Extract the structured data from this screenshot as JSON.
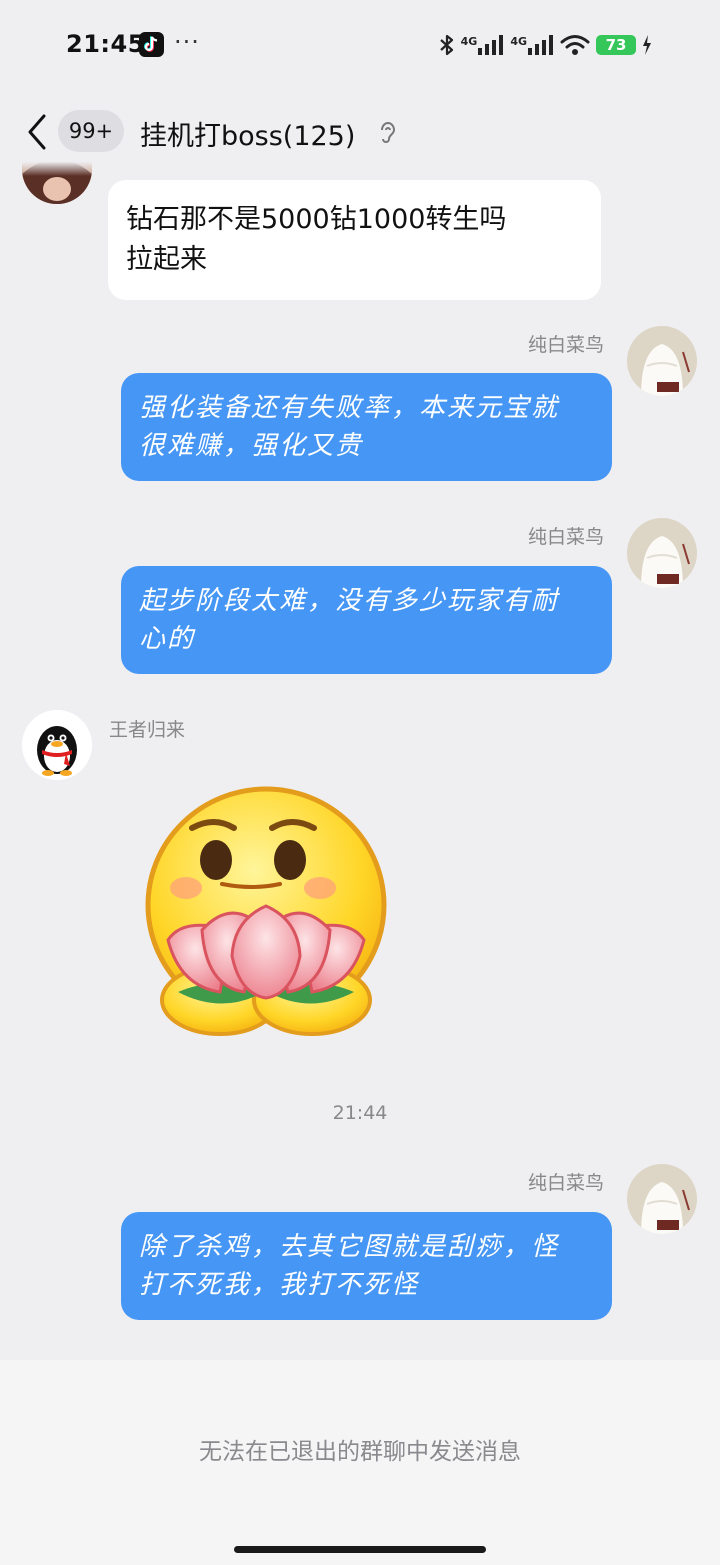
{
  "status_bar": {
    "time": "21:45",
    "more": "···",
    "net1": "4G",
    "net2": "4G",
    "battery": "73",
    "icons": [
      "tiktok-icon",
      "bluetooth-icon",
      "signal-icon",
      "wifi-icon",
      "battery-icon",
      "charging-icon"
    ]
  },
  "header": {
    "unread_badge": "99+",
    "title": "挂机打boss(125)",
    "icons": [
      "back-arrow-icon",
      "ear-icon"
    ]
  },
  "messages": [
    {
      "type": "incoming",
      "text_lines": [
        "钻石那不是5000钻1000转生吗",
        "拉起来"
      ]
    },
    {
      "type": "outgoing",
      "sender": "纯白菜鸟",
      "text_lines": [
        "强化装备还有失败率，本来元宝就",
        "很难赚，强化又贵"
      ]
    },
    {
      "type": "outgoing",
      "sender": "纯白菜鸟",
      "text_lines": [
        "起步阶段太难，没有多少玩家有耐",
        "心的"
      ]
    },
    {
      "type": "incoming_sticker",
      "sender": "王者归来",
      "sticker": "lotus-emoji-sticker"
    },
    {
      "type": "outgoing",
      "sender": "纯白菜鸟",
      "text_lines": [
        "除了杀鸡，去其它图就是刮痧，怪",
        "打不死我，我打不死怪"
      ]
    }
  ],
  "timestamp": "21:44",
  "footer": {
    "notice": "无法在已退出的群聊中发送消息"
  },
  "colors": {
    "background": "#efeff2",
    "outgoing_bubble": "#4596f5",
    "incoming_bubble": "#ffffff",
    "battery": "#35c759"
  }
}
